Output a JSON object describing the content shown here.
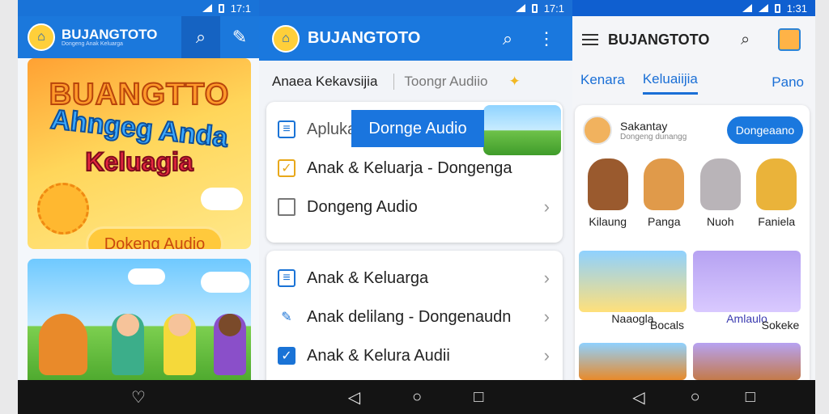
{
  "status": {
    "p1_time": "17:1",
    "p2_time": "17:1",
    "p3_time": "1:31"
  },
  "p1": {
    "app_title": "BUJANGTOTO",
    "app_subtitle": "Dongeng Anak Keluarga",
    "hero_line1": "BUANGTTO",
    "hero_line2": "Ahngeg Anda",
    "hero_line3": "Keluagia",
    "hero_button": "Dokeng Audio"
  },
  "p2": {
    "app_title": "BUJANGTOTO",
    "tabs": [
      "Anaea Kekavsijia",
      "Toongr Audiio"
    ],
    "highlight_label": "Dornge Audio",
    "card1": [
      {
        "label": "Aplukasa"
      },
      {
        "label": "Anak & Keluarja - Dongenga"
      },
      {
        "label": "Dongeng Audio"
      }
    ],
    "card2": [
      {
        "label": "Anak & Keluarga"
      },
      {
        "label": "Anak delilang - Dongenaudn"
      },
      {
        "label": "Anak & Kelura Audii"
      }
    ]
  },
  "p3": {
    "app_title": "BUJANGTOTO",
    "tabs": [
      "Kenara",
      "Keluaiijia",
      "Pano"
    ],
    "story_name": "Sakantay",
    "story_sub": "Dongeng dunangg",
    "follow_button": "Dongeaano",
    "characters": [
      "Kilaung",
      "Panga",
      "Nuoh",
      "Faniela"
    ],
    "tiles": [
      "Naaogla",
      "Bocals",
      "Amlaulo",
      "Sokeke"
    ]
  },
  "colors": {
    "primary_blue": "#1a78de",
    "status_blue": "#0f5fd0",
    "nav_black": "#141414"
  },
  "icons": [
    "search-icon",
    "edit-icon",
    "more-vert-icon",
    "menu-icon",
    "back-icon",
    "home-icon",
    "recents-icon",
    "heart-icon"
  ]
}
